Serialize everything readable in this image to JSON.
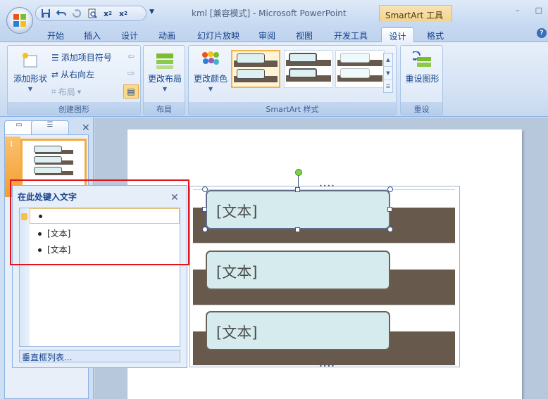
{
  "app": {
    "window_title": "kml [兼容模式] - Microsoft PowerPoint",
    "context_tab_title": "SmartArt 工具",
    "window_buttons": [
      "–",
      "□"
    ],
    "help_label": "?"
  },
  "quick_access": {
    "more_glyph": "▼",
    "items": [
      {
        "name": "save-icon",
        "glyph": "💾"
      },
      {
        "name": "undo-icon",
        "glyph": "↶"
      },
      {
        "name": "redo-icon",
        "glyph": "↻"
      },
      {
        "name": "print-preview-icon",
        "glyph": "🔍"
      },
      {
        "name": "superscript-icon",
        "glyph": "x²"
      },
      {
        "name": "subscript-icon",
        "glyph": "x₂"
      }
    ]
  },
  "tabs": [
    "开始",
    "插入",
    "设计",
    "动画",
    "幻灯片放映",
    "审阅",
    "视图",
    "开发工具",
    "设计",
    "格式"
  ],
  "active_tab_index": 8,
  "ribbon": {
    "create_graphic": {
      "label": "创建图形",
      "add_shape": "添加形状",
      "add_bullet": "添加项目符号",
      "right_to_left": "从右向左",
      "layout": "布局"
    },
    "layouts": {
      "label": "布局",
      "change_layout": "更改布局"
    },
    "smartart_styles": {
      "label": "SmartArt 样式",
      "change_colors": "更改颜色"
    },
    "reset": {
      "label": "重设",
      "reset_graphic": "重设图形"
    }
  },
  "slides_pane": {
    "slide_number": "1",
    "close_glyph": "✕"
  },
  "text_pane": {
    "title": "在此处键入文字",
    "close_glyph": "✕",
    "items": [
      "",
      "[文本]",
      "[文本]"
    ],
    "footer": "垂直框列表..."
  },
  "smartart": {
    "boxes": [
      "[文本]",
      "[文本]",
      "[文本]"
    ],
    "grip": "••••"
  },
  "colors": {
    "accent_border": "#e3141a",
    "band": "#675a4d",
    "box_fill": "#d6ebed",
    "rotation_handle": "#7ed145"
  }
}
